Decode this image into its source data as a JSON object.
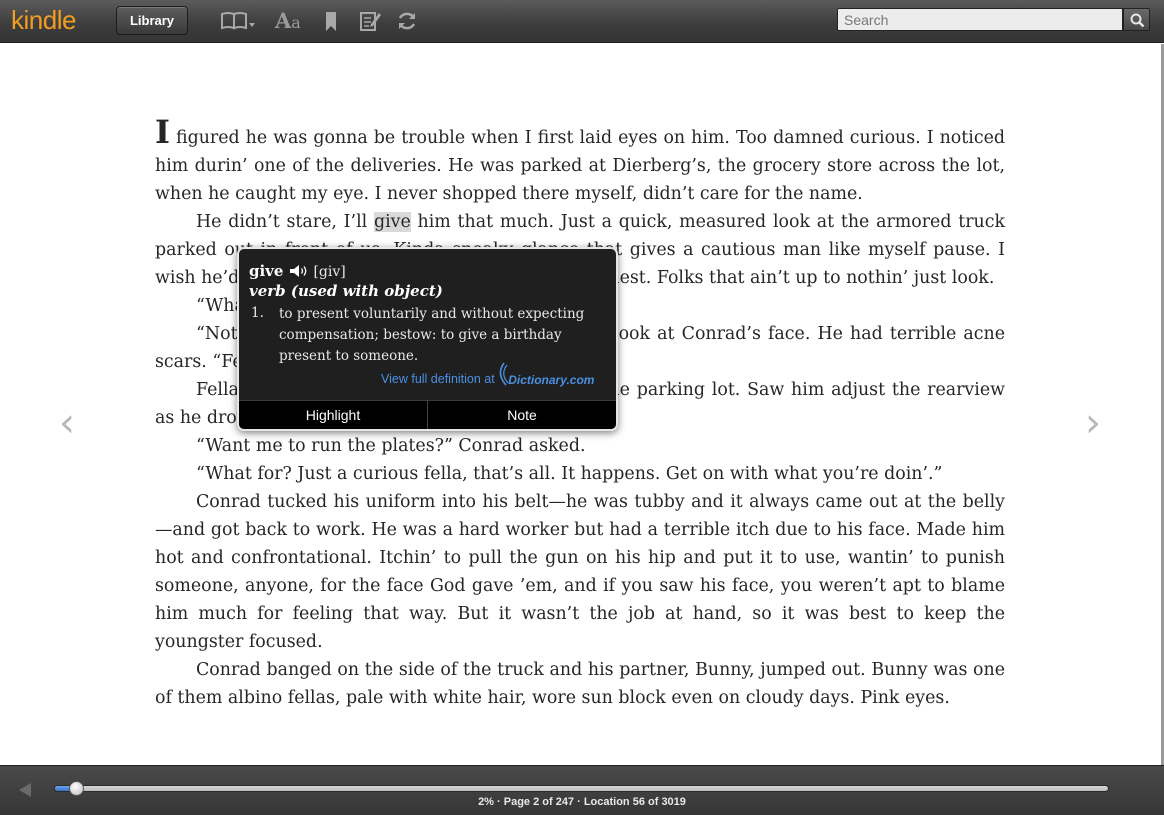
{
  "toolbar": {
    "logo": "kindle",
    "library_label": "Library",
    "icons": [
      "book-view-icon",
      "font-size-icon",
      "bookmark-icon",
      "notes-icon",
      "sync-icon"
    ],
    "font_icon_text_large": "A",
    "font_icon_text_small": "a",
    "search_placeholder": "Search",
    "search_value": "",
    "logo_color": "#f29c21"
  },
  "book": {
    "dropcap": "I",
    "paragraphs": [
      " figured he was gonna be trouble when I first laid eyes on him. Too damned curious. I noticed him durin’ one of the deliveries. He was parked at Dierberg’s, the grocery store across the lot, when he caught my eye. I never shopped there myself, didn’t care for the name.",
      {
        "before": "He didn’t stare, I’ll ",
        "highlight": "give",
        "after": " him that much. Just a quick, measured look at the armored truck parked out in front of us. Kinda sneaky glance that gives a cautious man like myself pause. I wish he’d looked harder. Would at least be more honest. Folks that ain’t up to nothin’ just look."
      },
      "“What you lookin’ at, Bob?” Conrad asked.",
      "“Nothin’,” I said, watchin’ him, careful not to look at Conrad’s face. He had terrible acne scars. “Fella’s goin’ now.”",
      "Fella climbed into his sedan and pulled outa the parking lot. Saw him adjust the rearview as he drove off.",
      "“Want me to run the plates?” Conrad asked.",
      "“What for? Just a curious fella, that’s all. It happens. Get on with what you’re doin’.”",
      "Conrad tucked his uniform into his belt—he was tubby and it always came out at the belly—and got back to work. He was a hard worker but had a terrible itch due to his face. Made him hot and confrontational. Itchin’ to pull the gun on his hip and put it to use, wantin’ to punish someone, anyone, for the face God gave ’em, and if you saw his face, you weren’t apt to blame him much for feeling that way. But it wasn’t the job at hand, so it was best to keep the youngster focused.",
      "Conrad banged on the side of the truck and his partner, Bunny, jumped out. Bunny was one of them albino fellas, pale with white hair, wore sun block even on cloudy days. Pink eyes."
    ]
  },
  "navigation": {
    "prev_glyph": "‹",
    "next_glyph": "›"
  },
  "dictionary": {
    "word": "give",
    "pronunciation": "[giv]",
    "part_of_speech": "verb (used with object)",
    "sense_number": "1.",
    "definition": "to present voluntarily and without expecting compensation; bestow: to give a birthday present to someone.",
    "link_text": "View full definition at",
    "source_logo": "Dictionary.com",
    "actions": [
      "Highlight",
      "Note"
    ]
  },
  "progress": {
    "percent": 2,
    "location_text": "2% · Page 2 of 247 · Location 56 of 3019"
  }
}
